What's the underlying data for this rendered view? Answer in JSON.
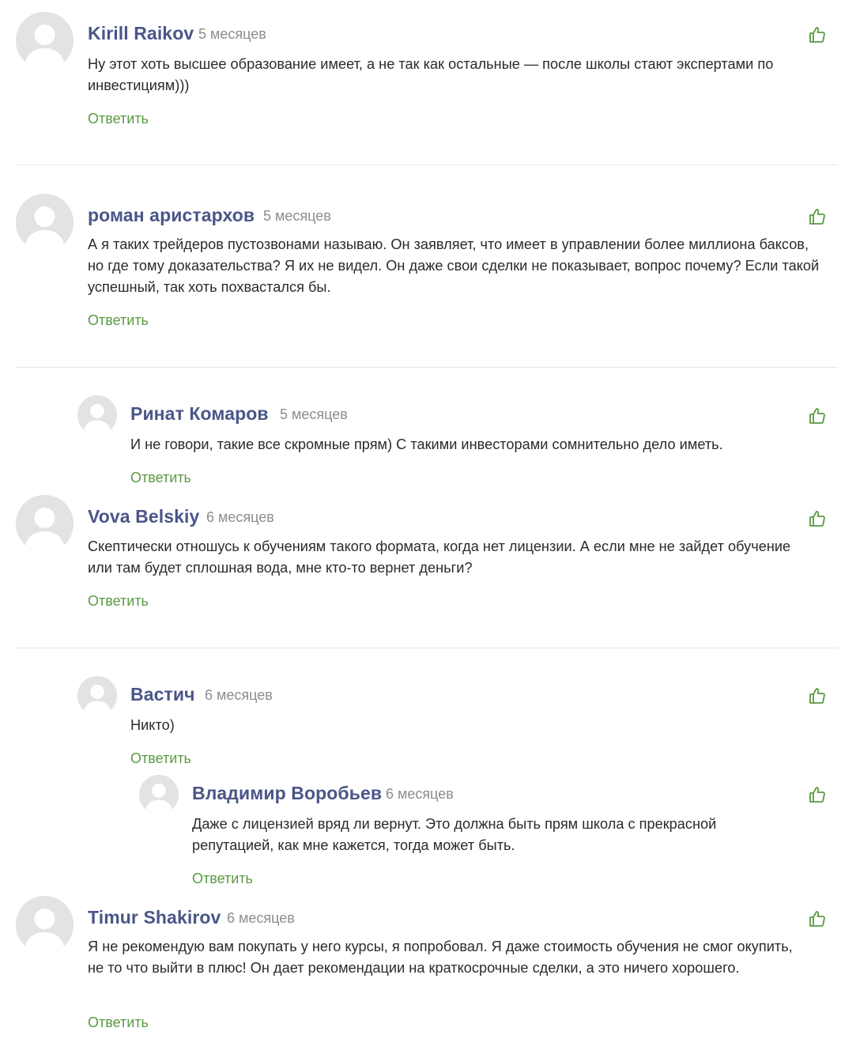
{
  "comments": [
    {
      "author": "Kirill Raikov",
      "time": "5 месяцев",
      "text": "Ну этот хоть высшее образование имеет, а не так как остальные — после школы стают экспертами по инвестициям)))",
      "reply": "Ответить",
      "icon": "thumbs-up-icon"
    },
    {
      "author": "роман аристархов",
      "time": "5 месяцев",
      "text": "А я таких трейдеров пустозвонами называю. Он заявляет, что имеет в управлении более миллиона баксов, но где тому доказательства? Я их не видел. Он даже свои сделки не показывает, вопрос почему? Если такой успешный, так хоть похвастался бы.",
      "reply": "Ответить",
      "icon": "thumbs-up-icon"
    },
    {
      "author": "Ринат Комаров",
      "time": "5 месяцев",
      "text": "И не говори, такие все скромные прям) С такими инвесторами сомнительно дело иметь.",
      "reply": "Ответить",
      "icon": "thumbs-up-icon"
    },
    {
      "author": "Vova Belskiy",
      "time": "6 месяцев",
      "text": "Скептически отношусь к обучениям такого формата, когда нет лицензии. А если мне не зайдет обучение или там будет сплошная вода, мне кто-то вернет деньги?",
      "reply": "Ответить",
      "icon": "thumbs-up-icon"
    },
    {
      "author": "Вастич",
      "time": "6 месяцев",
      "text": "Никто)",
      "reply": "Ответить",
      "icon": "thumbs-up-icon"
    },
    {
      "author": "Владимир Воробьев",
      "time": "6 месяцев",
      "text": "Даже с лицензией вряд ли вернут. Это должна быть прям школа с прекрасной репутацией, как мне кажется, тогда может быть.",
      "reply": "Ответить",
      "icon": "thumbs-up-icon"
    },
    {
      "author": "Timur Shakirov",
      "time": "6 месяцев",
      "text": "Я не рекомендую вам покупать у него курсы, я попробовал. Я даже стоимость обучения не смог окупить, не то что выйти в плюс! Он дает рекомендации на краткосрочные сделки, а это ничего хорошего.",
      "reply": "Ответить",
      "icon": "thumbs-up-icon"
    }
  ],
  "colors": {
    "author": "#4a5688",
    "time": "#8d8d8d",
    "reply": "#5a9a43",
    "like_icon": "#5a9a43",
    "avatar_bg": "#e3e3e3",
    "avatar_fg": "#ffffff"
  }
}
